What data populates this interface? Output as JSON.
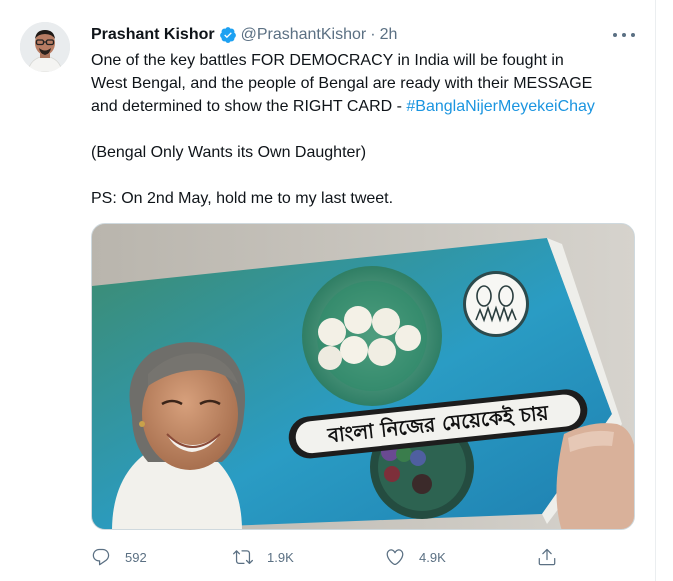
{
  "tweet": {
    "display_name": "Prashant Kishor",
    "handle": "@PrashantKishor",
    "separator": "·",
    "time": "2h",
    "line1": "One of the key battles FOR DEMOCRACY in India will be fought in",
    "line2": "West Bengal, and the people of Bengal are ready with their MESSAGE",
    "line3": "and determined to show the RIGHT CARD - ",
    "hashtag": "#BanglaNijerMeyekeiChay",
    "translation": "(Bengal Only Wants its Own Daughter)",
    "ps": "PS: On 2nd May, hold me to my last tweet."
  },
  "media": {
    "banner_text": "বাংলা নিজের মেয়েকেই চায়"
  },
  "actions": {
    "replies": "592",
    "retweets": "1.9K",
    "likes": "4.9K"
  },
  "icons": {
    "verified": "verified-badge-icon",
    "more": "more-options-icon",
    "reply": "reply-icon",
    "retweet": "retweet-icon",
    "like": "like-icon",
    "share": "share-icon"
  },
  "colors": {
    "verified_blue": "#1da1f2",
    "hashtag_blue": "#1b95e0",
    "secondary_text": "#5b7083",
    "card_teal": "#2a9cc4",
    "card_green": "#3e8b6c"
  }
}
